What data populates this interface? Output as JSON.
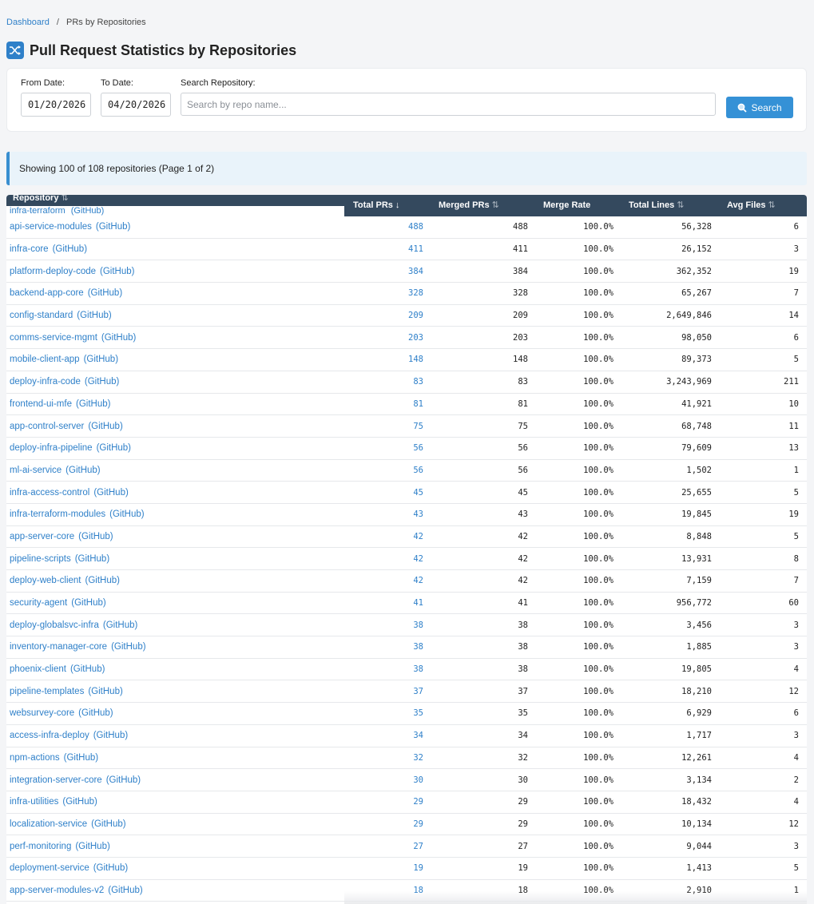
{
  "breadcrumb": {
    "home": "Dashboard",
    "separator": "/",
    "current": "PRs by Repositories"
  },
  "page": {
    "title": "Pull Request Statistics by Repositories",
    "icon": "shuffle-icon"
  },
  "filters": {
    "from_label": "From Date:",
    "from_value": "01/20/2026",
    "to_label": "To Date:",
    "to_value": "04/20/2026",
    "search_label": "Search Repository:",
    "search_placeholder": "Search by repo name...",
    "search_value": "",
    "search_button": "Search",
    "search_button_icon": "magnifier-icon"
  },
  "summary": "Showing 100 of 108 repositories (Page 1 of 2)",
  "table": {
    "columns": {
      "repo": "Repository",
      "total": "Total PRs",
      "merged": "Merged PRs",
      "rate": "Merge Rate",
      "lines": "Total Lines",
      "files": "Avg Files"
    },
    "sort_active": "↓",
    "sort_idle": "⇅",
    "provider_label": "(GitHub)",
    "sticky_row": {
      "repo": "infra-terraform",
      "provider": "(GitHub)"
    },
    "rows": [
      {
        "repo": "api-service-modules",
        "total": "488",
        "merged": "488",
        "rate": "100.0%",
        "lines": "56,328",
        "files": "6"
      },
      {
        "repo": "infra-core",
        "total": "411",
        "merged": "411",
        "rate": "100.0%",
        "lines": "26,152",
        "files": "3"
      },
      {
        "repo": "platform-deploy-code",
        "total": "384",
        "merged": "384",
        "rate": "100.0%",
        "lines": "362,352",
        "files": "19"
      },
      {
        "repo": "backend-app-core",
        "total": "328",
        "merged": "328",
        "rate": "100.0%",
        "lines": "65,267",
        "files": "7"
      },
      {
        "repo": "config-standard",
        "total": "209",
        "merged": "209",
        "rate": "100.0%",
        "lines": "2,649,846",
        "files": "14"
      },
      {
        "repo": "comms-service-mgmt",
        "total": "203",
        "merged": "203",
        "rate": "100.0%",
        "lines": "98,050",
        "files": "6"
      },
      {
        "repo": "mobile-client-app",
        "total": "148",
        "merged": "148",
        "rate": "100.0%",
        "lines": "89,373",
        "files": "5"
      },
      {
        "repo": "deploy-infra-code",
        "total": "83",
        "merged": "83",
        "rate": "100.0%",
        "lines": "3,243,969",
        "files": "211"
      },
      {
        "repo": "frontend-ui-mfe",
        "total": "81",
        "merged": "81",
        "rate": "100.0%",
        "lines": "41,921",
        "files": "10"
      },
      {
        "repo": "app-control-server",
        "total": "75",
        "merged": "75",
        "rate": "100.0%",
        "lines": "68,748",
        "files": "11"
      },
      {
        "repo": "deploy-infra-pipeline",
        "total": "56",
        "merged": "56",
        "rate": "100.0%",
        "lines": "79,609",
        "files": "13"
      },
      {
        "repo": "ml-ai-service",
        "total": "56",
        "merged": "56",
        "rate": "100.0%",
        "lines": "1,502",
        "files": "1"
      },
      {
        "repo": "infra-access-control",
        "total": "45",
        "merged": "45",
        "rate": "100.0%",
        "lines": "25,655",
        "files": "5"
      },
      {
        "repo": "infra-terraform-modules",
        "total": "43",
        "merged": "43",
        "rate": "100.0%",
        "lines": "19,845",
        "files": "19"
      },
      {
        "repo": "app-server-core",
        "total": "42",
        "merged": "42",
        "rate": "100.0%",
        "lines": "8,848",
        "files": "5"
      },
      {
        "repo": "pipeline-scripts",
        "total": "42",
        "merged": "42",
        "rate": "100.0%",
        "lines": "13,931",
        "files": "8"
      },
      {
        "repo": "deploy-web-client",
        "total": "42",
        "merged": "42",
        "rate": "100.0%",
        "lines": "7,159",
        "files": "7"
      },
      {
        "repo": "security-agent",
        "total": "41",
        "merged": "41",
        "rate": "100.0%",
        "lines": "956,772",
        "files": "60"
      },
      {
        "repo": "deploy-globalsvc-infra",
        "total": "38",
        "merged": "38",
        "rate": "100.0%",
        "lines": "3,456",
        "files": "3"
      },
      {
        "repo": "inventory-manager-core",
        "total": "38",
        "merged": "38",
        "rate": "100.0%",
        "lines": "1,885",
        "files": "3"
      },
      {
        "repo": "phoenix-client",
        "total": "38",
        "merged": "38",
        "rate": "100.0%",
        "lines": "19,805",
        "files": "4"
      },
      {
        "repo": "pipeline-templates",
        "total": "37",
        "merged": "37",
        "rate": "100.0%",
        "lines": "18,210",
        "files": "12"
      },
      {
        "repo": "websurvey-core",
        "total": "35",
        "merged": "35",
        "rate": "100.0%",
        "lines": "6,929",
        "files": "6"
      },
      {
        "repo": "access-infra-deploy",
        "total": "34",
        "merged": "34",
        "rate": "100.0%",
        "lines": "1,717",
        "files": "3"
      },
      {
        "repo": "npm-actions",
        "total": "32",
        "merged": "32",
        "rate": "100.0%",
        "lines": "12,261",
        "files": "4"
      },
      {
        "repo": "integration-server-core",
        "total": "30",
        "merged": "30",
        "rate": "100.0%",
        "lines": "3,134",
        "files": "2"
      },
      {
        "repo": "infra-utilities",
        "total": "29",
        "merged": "29",
        "rate": "100.0%",
        "lines": "18,432",
        "files": "4"
      },
      {
        "repo": "localization-service",
        "total": "29",
        "merged": "29",
        "rate": "100.0%",
        "lines": "10,134",
        "files": "12"
      },
      {
        "repo": "perf-monitoring",
        "total": "27",
        "merged": "27",
        "rate": "100.0%",
        "lines": "9,044",
        "files": "3"
      },
      {
        "repo": "deployment-service",
        "total": "19",
        "merged": "19",
        "rate": "100.0%",
        "lines": "1,413",
        "files": "5"
      },
      {
        "repo": "app-server-modules-v2",
        "total": "18",
        "merged": "18",
        "rate": "100.0%",
        "lines": "2,910",
        "files": "1"
      }
    ]
  }
}
